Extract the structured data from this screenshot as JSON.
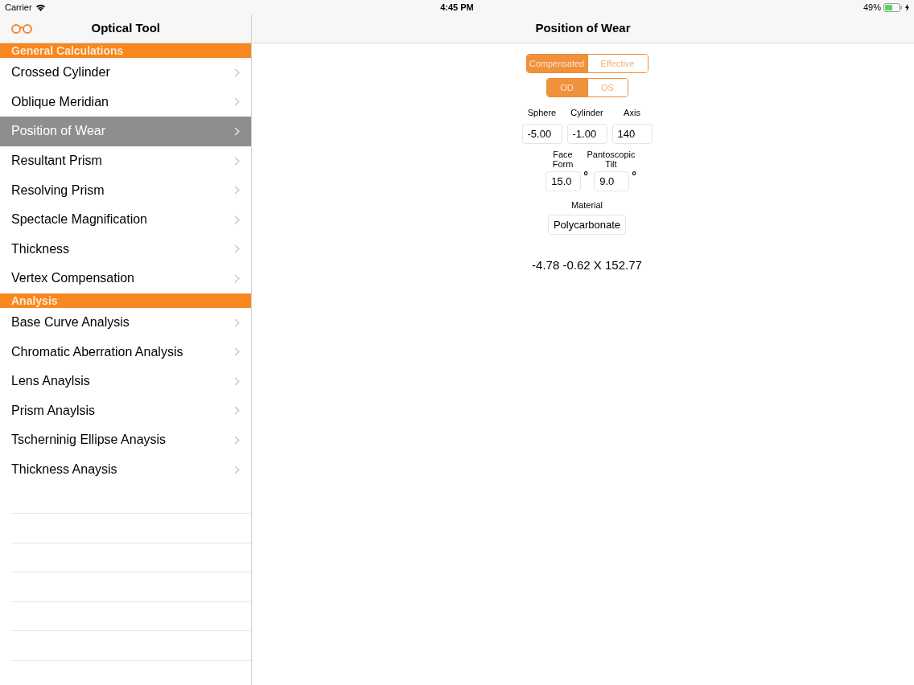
{
  "status_bar": {
    "carrier": "Carrier",
    "time": "4:45 PM",
    "battery": "49%"
  },
  "sidebar": {
    "title": "Optical Tool",
    "sections": [
      {
        "title": "General Calculations",
        "items": [
          {
            "label": "Crossed Cylinder",
            "selected": false
          },
          {
            "label": "Oblique Meridian",
            "selected": false
          },
          {
            "label": "Position of Wear",
            "selected": true
          },
          {
            "label": "Resultant Prism",
            "selected": false
          },
          {
            "label": "Resolving Prism",
            "selected": false
          },
          {
            "label": "Spectacle Magnification",
            "selected": false
          },
          {
            "label": "Thickness",
            "selected": false
          },
          {
            "label": "Vertex Compensation",
            "selected": false
          }
        ]
      },
      {
        "title": "Analysis",
        "items": [
          {
            "label": "Base Curve Analysis",
            "selected": false
          },
          {
            "label": "Chromatic Aberration Analysis",
            "selected": false
          },
          {
            "label": "Lens Anaylsis",
            "selected": false
          },
          {
            "label": "Prism Anaylsis",
            "selected": false
          },
          {
            "label": "Tscherninig Ellipse Anaysis",
            "selected": false
          },
          {
            "label": "Thickness Anaysis",
            "selected": false
          }
        ]
      }
    ]
  },
  "detail": {
    "title": "Position of Wear",
    "mode_segments": [
      {
        "label": "Compensated",
        "selected": true
      },
      {
        "label": "Effective",
        "selected": false
      }
    ],
    "eye_segments": [
      {
        "label": "OD",
        "selected": true
      },
      {
        "label": "OS",
        "selected": false
      }
    ],
    "fields": [
      {
        "label": "Sphere",
        "value": "-5.00"
      },
      {
        "label": "Cylinder",
        "value": "-1.00"
      },
      {
        "label": "Axis",
        "value": "140"
      }
    ],
    "angle_fields": [
      {
        "label": "Face Form",
        "value": "15.0",
        "unit": "°"
      },
      {
        "label": "Pantoscopic Tilt",
        "value": "9.0",
        "unit": "°"
      }
    ],
    "material": {
      "label": "Material",
      "value": "Polycarbonate"
    },
    "result": "-4.78 -0.62 X 152.77"
  }
}
